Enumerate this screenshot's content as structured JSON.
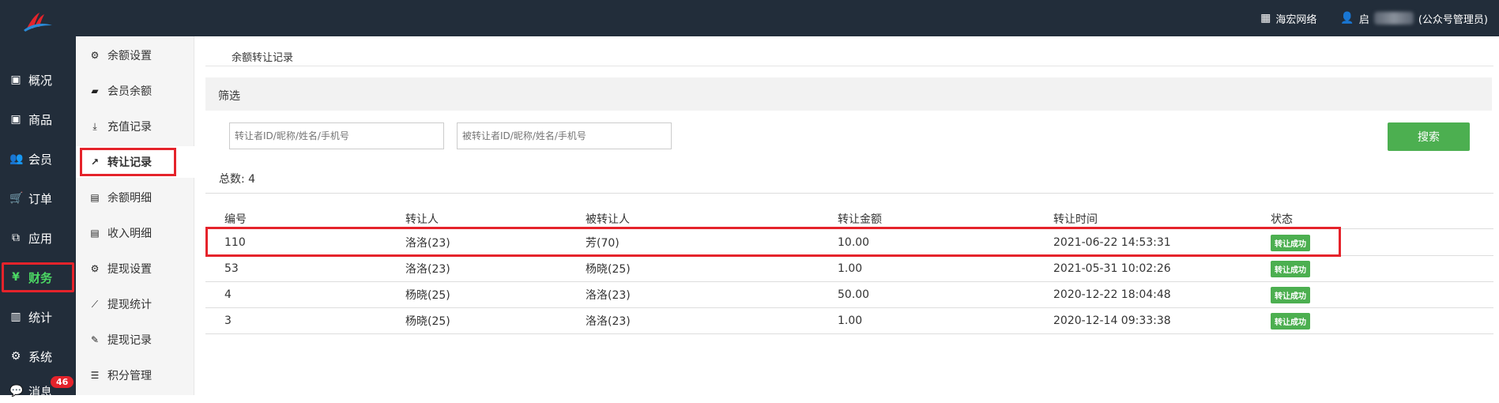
{
  "topbar": {
    "org_label": "海宏网络",
    "user_initial": "启",
    "user_role": "(公众号管理员)",
    "icons": [
      "grid-icon",
      "user-icon"
    ]
  },
  "main_nav": [
    {
      "label": "概况",
      "icon": "archive-icon"
    },
    {
      "label": "商品",
      "icon": "archive-icon"
    },
    {
      "label": "会员",
      "icon": "users-icon"
    },
    {
      "label": "订单",
      "icon": "cart-icon"
    },
    {
      "label": "应用",
      "icon": "cubes-icon"
    },
    {
      "label": "财务",
      "icon": "yen-icon",
      "active": true
    },
    {
      "label": "统计",
      "icon": "bar-chart-icon"
    },
    {
      "label": "系统",
      "icon": "cogs-icon"
    },
    {
      "label": "消息",
      "icon": "chat-icon",
      "badge": "46"
    }
  ],
  "sub_nav": [
    {
      "label": "余额设置",
      "icon": "gear-icon"
    },
    {
      "label": "会员余额",
      "icon": "book-icon"
    },
    {
      "label": "充值记录",
      "icon": "download-icon"
    },
    {
      "label": "转让记录",
      "icon": "external-link-icon",
      "active": true
    },
    {
      "label": "余额明细",
      "icon": "file-icon"
    },
    {
      "label": "收入明细",
      "icon": "file-icon"
    },
    {
      "label": "提现设置",
      "icon": "gear-icon"
    },
    {
      "label": "提现统计",
      "icon": "line-chart-icon"
    },
    {
      "label": "提现记录",
      "icon": "pencil-icon"
    },
    {
      "label": "积分管理",
      "icon": "database-icon"
    }
  ],
  "page": {
    "title": "余额转让记录",
    "filter_label": "筛选",
    "from_placeholder": "转让者ID/昵称/姓名/手机号",
    "to_placeholder": "被转让者ID/昵称/姓名/手机号",
    "search_label": "搜索",
    "total_label": "总数: 4"
  },
  "table": {
    "headers": [
      "编号",
      "转让人",
      "被转让人",
      "转让金额",
      "转让时间",
      "状态"
    ],
    "rows": [
      {
        "id": "110",
        "from": "洛洛(23)",
        "to": "芳(70)",
        "amount": "10.00",
        "time": "2021-06-22 14:53:31",
        "status": "转让成功"
      },
      {
        "id": "53",
        "from": "洛洛(23)",
        "to": "杨晓(25)",
        "amount": "1.00",
        "time": "2021-05-31 10:02:26",
        "status": "转让成功"
      },
      {
        "id": "4",
        "from": "杨晓(25)",
        "to": "洛洛(23)",
        "amount": "50.00",
        "time": "2020-12-22 18:04:48",
        "status": "转让成功"
      },
      {
        "id": "3",
        "from": "杨晓(25)",
        "to": "洛洛(23)",
        "amount": "1.00",
        "time": "2020-12-14 09:33:38",
        "status": "转让成功"
      }
    ]
  },
  "colors": {
    "nav_bg": "#222d3a",
    "accent_green": "#4caf50",
    "highlight_red": "#e5232b"
  }
}
